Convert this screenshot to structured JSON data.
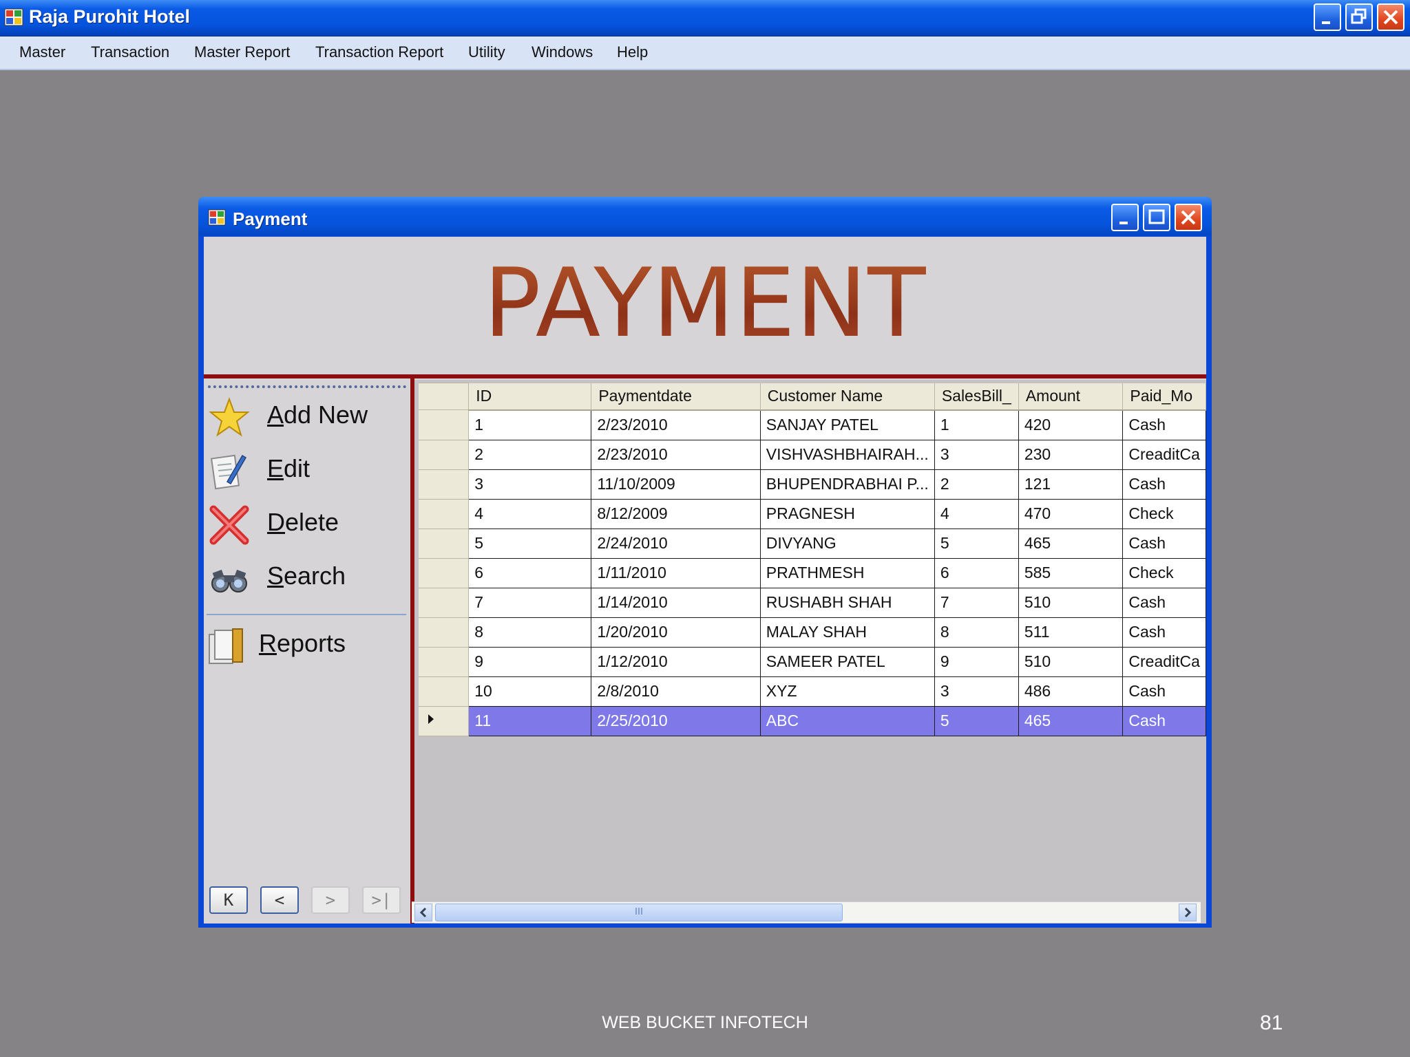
{
  "app": {
    "title": "Raja Purohit Hotel"
  },
  "menu": [
    {
      "label": "Master"
    },
    {
      "label": "Transaction"
    },
    {
      "label": "Master Report"
    },
    {
      "label": "Transaction Report"
    },
    {
      "label": "Utility"
    },
    {
      "label": "Windows"
    },
    {
      "label": "Help"
    }
  ],
  "child": {
    "title": "Payment",
    "heading": "PAYMENT"
  },
  "side": {
    "add_new": "Add New",
    "edit": "Edit",
    "delete": "Delete",
    "search": "Search",
    "reports": "Reports",
    "nav": {
      "first": "K",
      "prev": "<",
      "next": ">",
      "last": ">|"
    }
  },
  "grid": {
    "columns": [
      "ID",
      "Paymentdate",
      "Customer Name",
      "SalesBill_",
      "Amount",
      "Paid_Mo"
    ],
    "rows": [
      [
        "1",
        "2/23/2010",
        "SANJAY PATEL",
        "1",
        "420",
        "Cash"
      ],
      [
        "2",
        "2/23/2010",
        "VISHVASHBHAIRAH...",
        "3",
        "230",
        "CreaditCa"
      ],
      [
        "3",
        "11/10/2009",
        "BHUPENDRABHAI P...",
        "2",
        "121",
        "Cash"
      ],
      [
        "4",
        "8/12/2009",
        "PRAGNESH",
        "4",
        "470",
        "Check"
      ],
      [
        "5",
        "2/24/2010",
        "DIVYANG",
        "5",
        "465",
        "Cash"
      ],
      [
        "6",
        "1/11/2010",
        "PRATHMESH",
        "6",
        "585",
        "Check"
      ],
      [
        "7",
        "1/14/2010",
        "RUSHABH SHAH",
        "7",
        "510",
        "Cash"
      ],
      [
        "8",
        "1/20/2010",
        "MALAY SHAH",
        "8",
        "511",
        "Cash"
      ],
      [
        "9",
        "1/12/2010",
        "SAMEER PATEL",
        "9",
        "510",
        "CreaditCa"
      ],
      [
        "10",
        "2/8/2010",
        "XYZ",
        "3",
        "486",
        "Cash"
      ],
      [
        "11",
        "2/25/2010",
        "ABC",
        "5",
        "465",
        "Cash"
      ]
    ],
    "selected_row": 10,
    "selection_color": "#7e78e8"
  },
  "footer": {
    "company": "WEB BUCKET INFOTECH",
    "page": "81"
  },
  "colors": {
    "heading": "#9a3d1c",
    "accent_red": "#8c0e10",
    "titlebar": "#0654dc"
  }
}
